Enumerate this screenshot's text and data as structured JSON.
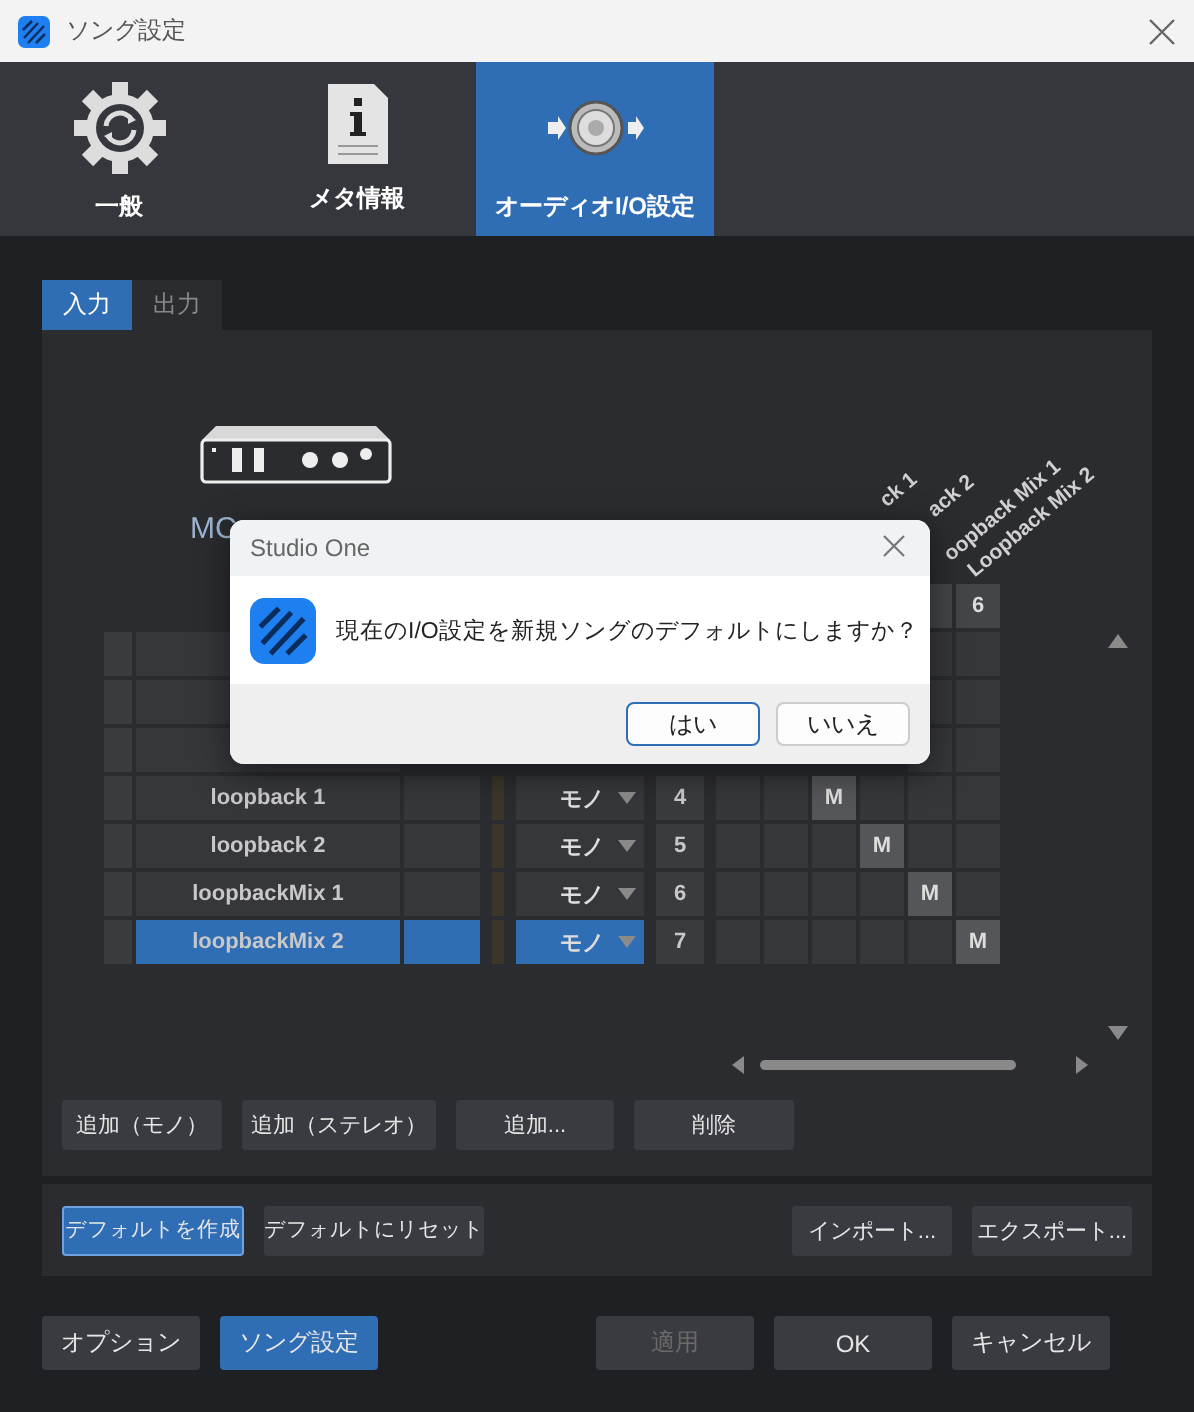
{
  "window": {
    "title": "ソング設定"
  },
  "categories": [
    {
      "label": "一般",
      "kind": "gear",
      "selected": false
    },
    {
      "label": "メタ情報",
      "kind": "info",
      "selected": false
    },
    {
      "label": "オーディオI/O設定",
      "kind": "audio",
      "selected": true
    }
  ],
  "io_tabs": [
    {
      "label": "入力",
      "selected": true
    },
    {
      "label": "出力",
      "selected": false
    }
  ],
  "device": {
    "name": "MC"
  },
  "matrix": {
    "column_headers": [
      "ck 1",
      "ack 2",
      "oopback Mix 1",
      "Loopback Mix 2"
    ],
    "column_numbers": [
      "6"
    ],
    "rows": [
      {
        "name": "loopback 1",
        "type": "モノ",
        "channel": "4",
        "selected": false,
        "cells": [
          {
            "mapped": false
          },
          {
            "mapped": false
          },
          {
            "mapped": true,
            "text": "M"
          },
          {
            "mapped": false
          },
          {
            "mapped": false
          },
          {
            "mapped": false
          }
        ]
      },
      {
        "name": "loopback 2",
        "type": "モノ",
        "channel": "5",
        "selected": false,
        "cells": [
          {
            "mapped": false
          },
          {
            "mapped": false
          },
          {
            "mapped": false
          },
          {
            "mapped": true,
            "text": "M"
          },
          {
            "mapped": false
          },
          {
            "mapped": false
          }
        ]
      },
      {
        "name": "loopbackMix 1",
        "type": "モノ",
        "channel": "6",
        "selected": false,
        "cells": [
          {
            "mapped": false
          },
          {
            "mapped": false
          },
          {
            "mapped": false
          },
          {
            "mapped": false
          },
          {
            "mapped": true,
            "text": "M"
          },
          {
            "mapped": false
          }
        ]
      },
      {
        "name": "loopbackMix 2",
        "type": "モノ",
        "channel": "7",
        "selected": true,
        "cells": [
          {
            "mapped": false
          },
          {
            "mapped": false
          },
          {
            "mapped": false
          },
          {
            "mapped": false
          },
          {
            "mapped": false
          },
          {
            "mapped": true,
            "text": "M"
          }
        ]
      }
    ]
  },
  "channel_buttons": [
    "追加（モノ）",
    "追加（ステレオ）",
    "追加...",
    "削除"
  ],
  "default_buttons": [
    {
      "label": "デフォルトを作成",
      "primary": true
    },
    {
      "label": "デフォルトにリセット",
      "primary": false
    }
  ],
  "file_buttons": [
    "インポート...",
    "エクスポート..."
  ],
  "footer": {
    "left": [
      {
        "label": "オプション",
        "selected": false
      },
      {
        "label": "ソング設定",
        "selected": true
      }
    ],
    "right": [
      {
        "label": "適用",
        "disabled": true
      },
      {
        "label": "OK",
        "disabled": false
      },
      {
        "label": "キャンセル",
        "disabled": false
      }
    ]
  },
  "dialog": {
    "title": "Studio One",
    "message": "現在のI/O設定を新規ソングのデフォルトにしますか？",
    "buttons": [
      {
        "label": "はい",
        "default": true
      },
      {
        "label": "いいえ",
        "default": false
      }
    ]
  }
}
